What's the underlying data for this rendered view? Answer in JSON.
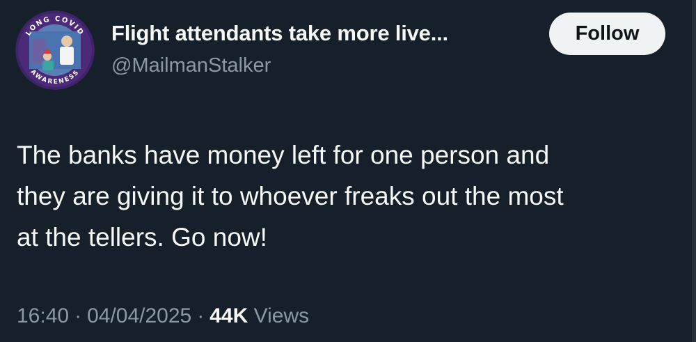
{
  "author": {
    "display_name": "Flight attendants take more live...",
    "handle": "@MailmanStalker",
    "avatar_ring_text_top": "LONG COVID",
    "avatar_ring_text_bottom": "AWARENESS"
  },
  "follow_button": {
    "label": "Follow"
  },
  "tweet": {
    "lines": [
      "The banks have money left for one person and",
      "they are giving it to whoever freaks out the most",
      "at the tellers. Go now!"
    ]
  },
  "meta": {
    "time": "16:40",
    "separator": "·",
    "date": "04/04/2025",
    "views_count": "44K",
    "views_label": "Views"
  },
  "colors": {
    "background": "#15202b",
    "primary_text": "#f7f9f9",
    "secondary_text": "#8b98a5",
    "follow_bg": "#eff3f4",
    "follow_text": "#0f1419",
    "avatar_ring": "#4b2a7a"
  }
}
